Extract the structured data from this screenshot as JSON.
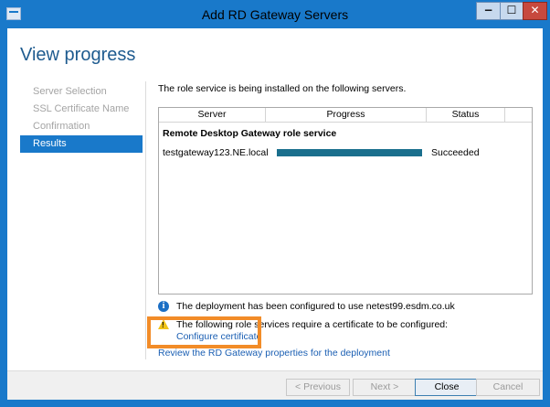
{
  "window": {
    "title": "Add RD Gateway Servers",
    "controls": {
      "minimize": "−",
      "maximize": "☐",
      "close": "✕"
    }
  },
  "page_title": "View progress",
  "nav": {
    "items": [
      {
        "label": "Server Selection",
        "active": false
      },
      {
        "label": "SSL Certificate Name",
        "active": false
      },
      {
        "label": "Confirmation",
        "active": false
      },
      {
        "label": "Results",
        "active": true
      }
    ]
  },
  "content": {
    "intro": "The role service is being installed on the following servers.",
    "table": {
      "columns": [
        "Server",
        "Progress",
        "Status"
      ],
      "group_title": "Remote Desktop Gateway role service",
      "rows": [
        {
          "server": "testgateway123.NE.local",
          "progress": 1.0,
          "status": "Succeeded"
        }
      ]
    },
    "info_message": "The deployment has been configured to use netest99.esdm.co.uk",
    "warning_message": "The following role services require a certificate to be configured:",
    "configure_link": "Configure certificate",
    "review_link": "Review the RD Gateway properties for the deployment"
  },
  "footer": {
    "previous": "< Previous",
    "next": "Next >",
    "close": "Close",
    "cancel": "Cancel"
  },
  "colors": {
    "accent": "#1979ca",
    "progress": "#1a6f8d",
    "highlight": "#f28c28",
    "link": "#1b5fb3"
  }
}
